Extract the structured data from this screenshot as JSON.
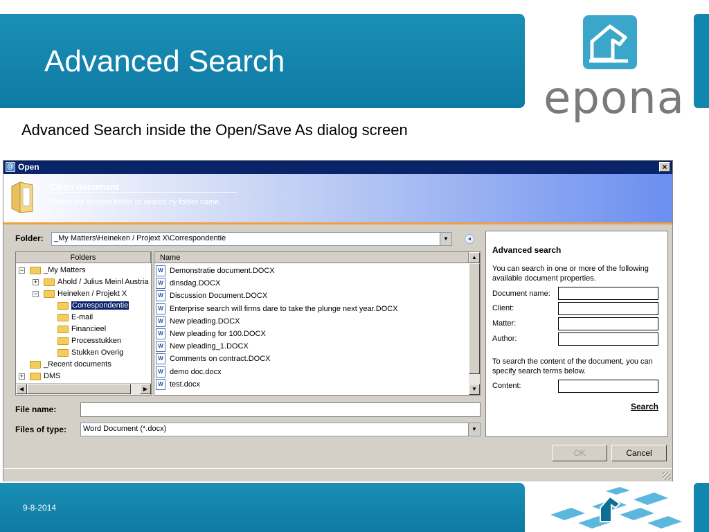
{
  "slide": {
    "title": "Advanced Search",
    "subtitle": "Advanced Search inside the Open/Save As dialog screen",
    "date": "9-8-2014"
  },
  "logo": {
    "text": "epona",
    "icon": "horse-chess-knight-icon"
  },
  "dialog": {
    "window_title": "Open",
    "app_icon_glyph": "@",
    "close_glyph": "×",
    "banner_title": "Open document",
    "banner_subtitle": "Select the desired folder or search by folder name.",
    "folder_label": "Folder:",
    "folder_value": "_My Matters\\Heineken / Projext X\\Correspondentie",
    "folders_header": "Folders",
    "name_header": "Name",
    "tree": [
      {
        "label": "_My Matters",
        "expander": "−",
        "icon": "star-icon"
      },
      {
        "label": "Ahold / Julius Meinl Austria",
        "expander": "+",
        "icon": "matter-folder-icon"
      },
      {
        "label": "Heineken / Projekt X",
        "expander": "−",
        "icon": "matter-folder-icon"
      },
      {
        "label": "Correspondentie",
        "icon": "folder-icon",
        "selected": true
      },
      {
        "label": "E-mail",
        "icon": "folder-icon"
      },
      {
        "label": "Financieel",
        "icon": "folder-icon"
      },
      {
        "label": "Processtukken",
        "icon": "folder-icon"
      },
      {
        "label": "Stukken Overig",
        "icon": "folder-icon"
      },
      {
        "label": "_Recent documents",
        "icon": "recent-documents-icon"
      },
      {
        "label": "DMS",
        "expander": "+",
        "icon": "dms-icon"
      }
    ],
    "files": [
      "Demonstratie document.DOCX",
      "dinsdag.DOCX",
      "Discussion Document.DOCX",
      "Enterprise search  will firms dare to take the plunge next year.DOCX",
      "New pleading.DOCX",
      "New pleading for 100.DOCX",
      "New pleading_1.DOCX",
      "Comments on contract.DOCX",
      "demo doc.docx",
      "test.docx"
    ],
    "file_name_label": "File name:",
    "file_name_value": "",
    "files_of_type_label": "Files of type:",
    "files_of_type_value": "Word Document (*.docx)",
    "ok_label": "OK",
    "cancel_label": "Cancel"
  },
  "advanced_search": {
    "title": "Advanced search",
    "intro": "You can search in one or more of the following available document properties.",
    "document_name_label": "Document name:",
    "client_label": "Client:",
    "matter_label": "Matter:",
    "author_label": "Author:",
    "content_intro": "To search the content of the document, you can specify search terms below.",
    "content_label": "Content:",
    "search_label": "Search"
  },
  "colors": {
    "header_blue": "#1a8fb5",
    "titlebar_navy": "#0a246a",
    "selection": "#0a246a",
    "logo_teal": "#3aa6c9",
    "logo_gray": "#7a7a7a"
  }
}
